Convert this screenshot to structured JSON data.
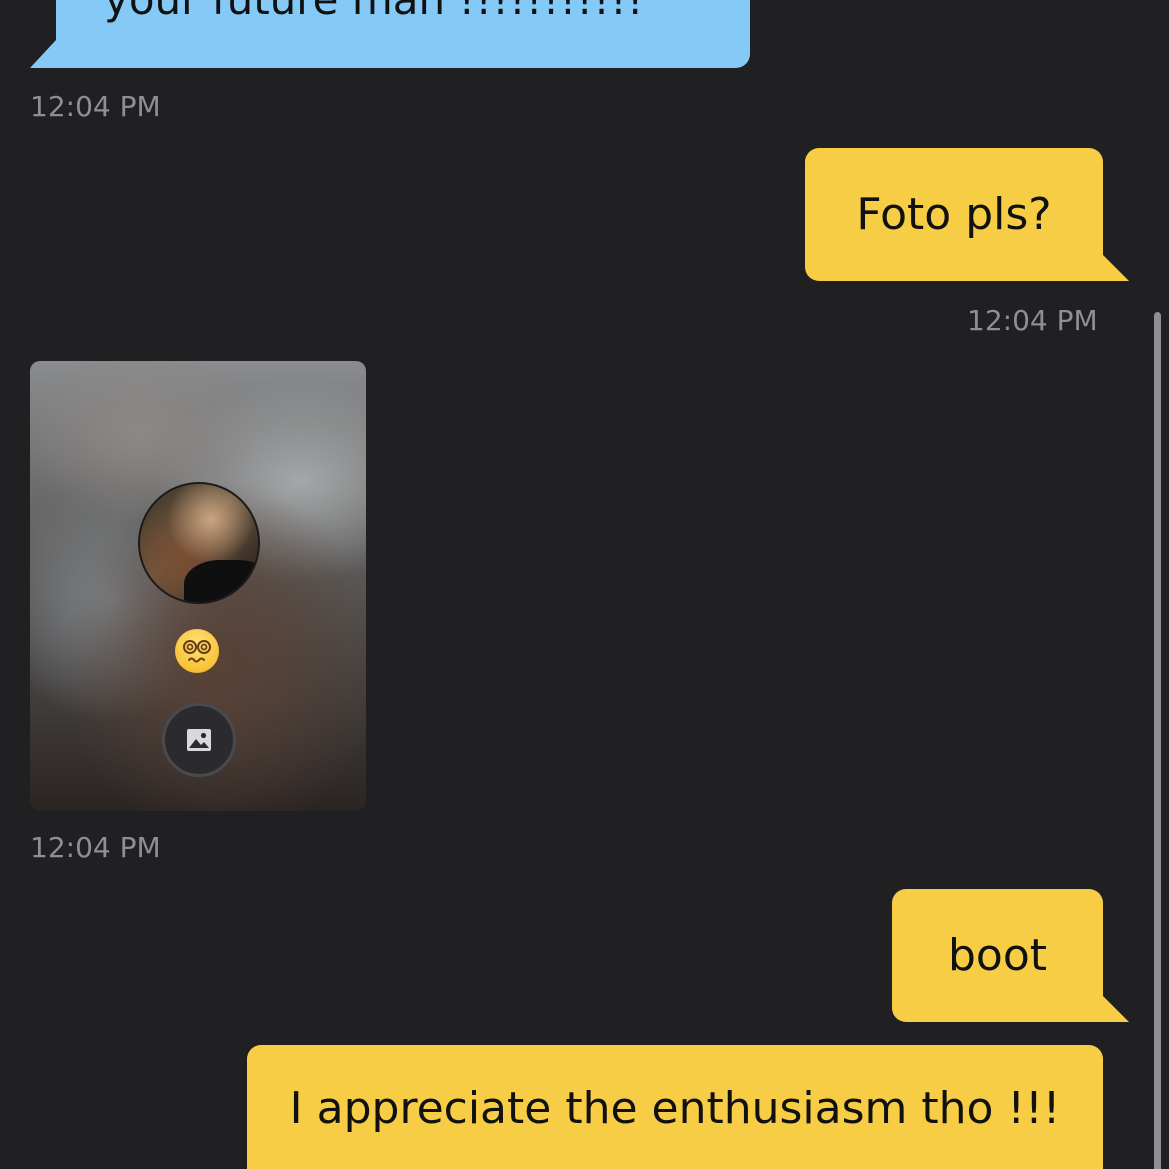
{
  "colors": {
    "background": "#202022",
    "incoming_bubble": "#85CAF6",
    "outgoing_bubble": "#F7CD45",
    "timestamp": "#8E8E93"
  },
  "messages": [
    {
      "direction": "incoming",
      "type": "text",
      "text": "your future man !!!!!!!!!!!"
    },
    {
      "direction": "incoming",
      "type": "timestamp",
      "time": "12:04 PM"
    },
    {
      "direction": "outgoing",
      "type": "text",
      "text": "Foto pls?"
    },
    {
      "direction": "outgoing",
      "type": "timestamp",
      "time": "12:04 PM"
    },
    {
      "direction": "incoming",
      "type": "photo",
      "emoji": "face-with-spiral-eyes",
      "icon": "image-icon"
    },
    {
      "direction": "incoming",
      "type": "timestamp",
      "time": "12:04 PM"
    },
    {
      "direction": "outgoing",
      "type": "text",
      "text": "boot"
    },
    {
      "direction": "outgoing",
      "type": "text",
      "text": "I appreciate the enthusiasm tho !!!"
    }
  ]
}
